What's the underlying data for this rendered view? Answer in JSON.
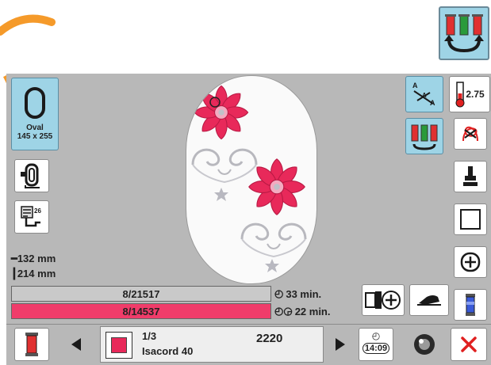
{
  "hoop": {
    "shape_name": "Oval",
    "size": "145 x 255"
  },
  "dimensions": {
    "width": "132 mm",
    "height": "214 mm"
  },
  "progress": {
    "total_stitches": "8/21517",
    "color_stitches": "8/14537",
    "total_fraction": 0.0004,
    "color_fraction": 0.0006
  },
  "time": {
    "total": "33 min.",
    "color": "22 min."
  },
  "tension": {
    "value": "2.75"
  },
  "current_color": {
    "index": "1/3",
    "thread_name": "Isacord 40",
    "thread_number": "2220",
    "swatch": "#e8295a"
  },
  "clock": {
    "time": "14:09"
  },
  "colors": {
    "screen_bg": "#b8b8b8",
    "active_button": "#9ed4e6",
    "progress_bar": "#f03c6a",
    "flower": "#e8295a",
    "arc_orange": "#f59a2a"
  },
  "icons": [
    "oval-hoop-icon",
    "hoop-select-icon",
    "stitch-count-icon",
    "multi-thread-icon",
    "thread-palette-icon",
    "tension-icon",
    "trim-icon",
    "presser-foot-icon",
    "frame-outline-icon",
    "center-icon",
    "spool-icon",
    "move-hoop-icon",
    "bobbin-icon",
    "prev-color-icon",
    "next-color-icon",
    "clock-icon",
    "ball-icon",
    "cancel-icon"
  ]
}
